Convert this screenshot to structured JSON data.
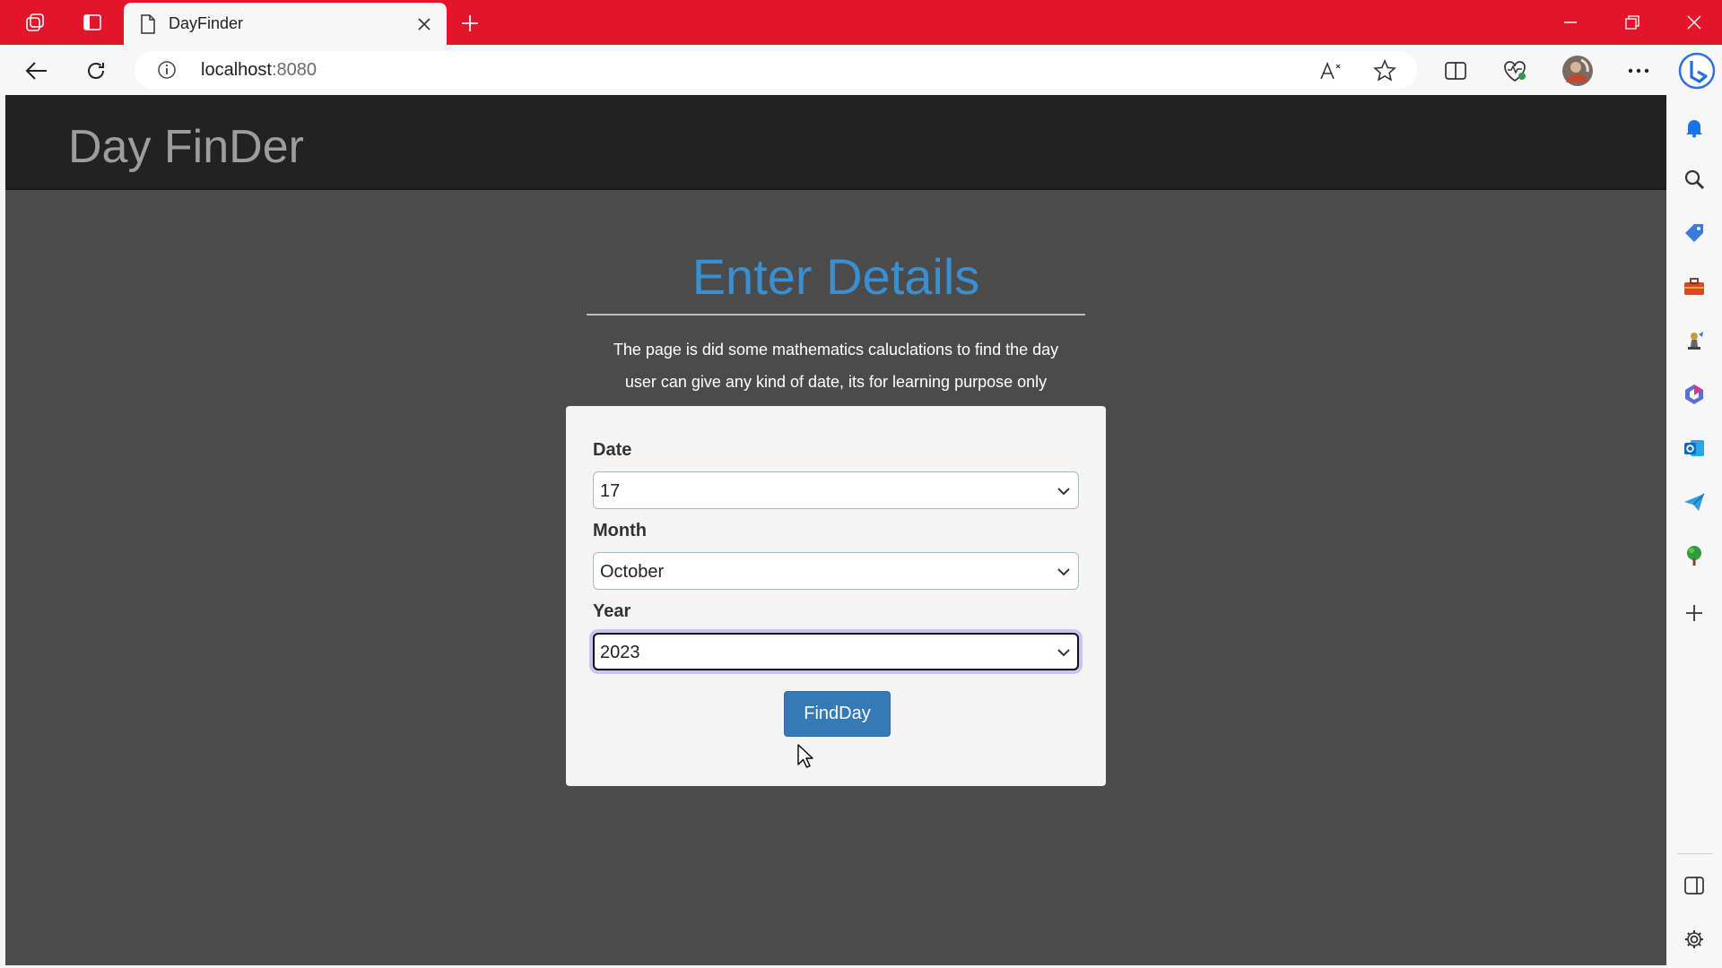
{
  "browser": {
    "tab_title": "DayFinder",
    "url_host": "localhost",
    "url_port": ":8080",
    "accent_color": "#e3152a"
  },
  "page": {
    "brand": "Day FinDer",
    "heading": "Enter Details",
    "description_line1": "The page is did some mathematics caluclations to find the day",
    "description_line2": "user can give any kind of date, its for learning purpose only",
    "form": {
      "date_label": "Date",
      "date_value": "17",
      "month_label": "Month",
      "month_value": "October",
      "year_label": "Year",
      "year_value": "2023",
      "submit_label": "FindDay"
    },
    "colors": {
      "navbar": "#222222",
      "background": "#4b4b4b",
      "heading": "#3a8fd0",
      "button": "#337ab7"
    }
  },
  "sidebar": {
    "icons": [
      "bell-icon",
      "search-icon",
      "tag-icon",
      "briefcase-icon",
      "chess-icon",
      "m365-icon",
      "outlook-icon",
      "send-icon",
      "tree-icon",
      "add-icon",
      "split-panel-icon",
      "settings-icon"
    ]
  }
}
